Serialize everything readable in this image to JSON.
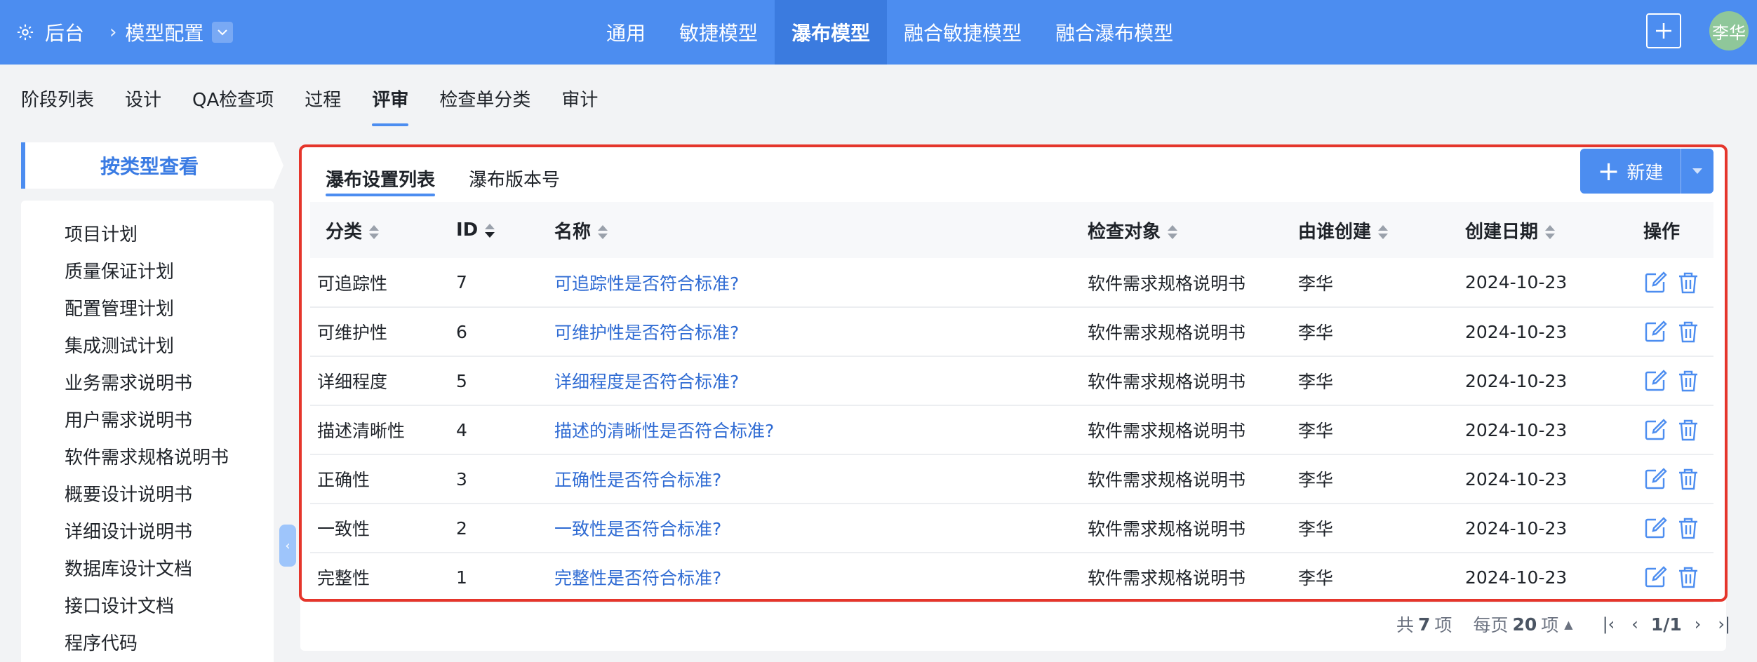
{
  "topbar": {
    "home": "后台",
    "breadcrumb": "模型配置",
    "nav": [
      "通用",
      "敏捷模型",
      "瀑布模型",
      "融合敏捷模型",
      "融合瀑布模型"
    ],
    "active_nav": "瀑布模型",
    "user": "李华"
  },
  "subtabs": [
    "阶段列表",
    "设计",
    "QA检查项",
    "过程",
    "评审",
    "检查单分类",
    "审计"
  ],
  "active_subtab": "评审",
  "sidebar": {
    "header": "按类型查看",
    "items": [
      "项目计划",
      "质量保证计划",
      "配置管理计划",
      "集成测试计划",
      "业务需求说明书",
      "用户需求说明书",
      "软件需求规格说明书",
      "概要设计说明书",
      "详细设计说明书",
      "数据库设计文档",
      "接口设计文档",
      "程序代码"
    ]
  },
  "main": {
    "tabs": [
      "瀑布设置列表",
      "瀑布版本号"
    ],
    "new_button": "新建",
    "columns": [
      "分类",
      "ID",
      "名称",
      "检查对象",
      "由谁创建",
      "创建日期",
      "操作"
    ],
    "rows": [
      {
        "category": "可追踪性",
        "id": "7",
        "name": "可追踪性是否符合标准?",
        "target": "软件需求规格说明书",
        "creator": "李华",
        "date": "2024-10-23"
      },
      {
        "category": "可维护性",
        "id": "6",
        "name": "可维护性是否符合标准?",
        "target": "软件需求规格说明书",
        "creator": "李华",
        "date": "2024-10-23"
      },
      {
        "category": "详细程度",
        "id": "5",
        "name": "详细程度是否符合标准?",
        "target": "软件需求规格说明书",
        "creator": "李华",
        "date": "2024-10-23"
      },
      {
        "category": "描述清晰性",
        "id": "4",
        "name": "描述的清晰性是否符合标准?",
        "target": "软件需求规格说明书",
        "creator": "李华",
        "date": "2024-10-23"
      },
      {
        "category": "正确性",
        "id": "3",
        "name": "正确性是否符合标准?",
        "target": "软件需求规格说明书",
        "creator": "李华",
        "date": "2024-10-23"
      },
      {
        "category": "一致性",
        "id": "2",
        "name": "一致性是否符合标准?",
        "target": "软件需求规格说明书",
        "creator": "李华",
        "date": "2024-10-23"
      },
      {
        "category": "完整性",
        "id": "1",
        "name": "完整性是否符合标准?",
        "target": "软件需求规格说明书",
        "creator": "李华",
        "date": "2024-10-23"
      }
    ]
  },
  "pager": {
    "total_prefix": "共",
    "total": "7",
    "total_suffix": "项",
    "per_page_prefix": "每页",
    "per_page": "20",
    "per_page_suffix": "项",
    "page": "1/1"
  },
  "colors": {
    "primary": "#4c8df0",
    "link": "#2f6bd3",
    "highlight": "#e5352b"
  }
}
